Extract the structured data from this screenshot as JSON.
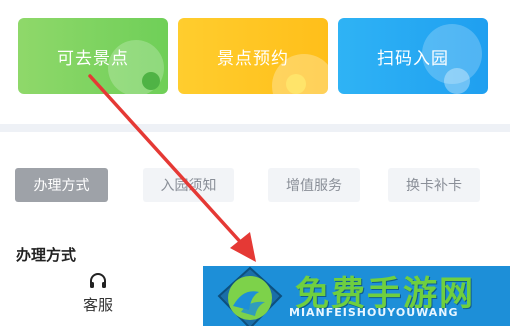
{
  "cards": [
    {
      "label": "可去景点",
      "color": "#6fcf58"
    },
    {
      "label": "景点预约",
      "color": "#ffc21f"
    },
    {
      "label": "扫码入园",
      "color": "#22a3f2"
    }
  ],
  "tabs": [
    {
      "label": "办理方式",
      "active": true
    },
    {
      "label": "入园须知",
      "active": false
    },
    {
      "label": "增值服务",
      "active": false
    },
    {
      "label": "换卡补卡",
      "active": false
    }
  ],
  "section": {
    "title": "办理方式"
  },
  "service": {
    "label": "客服",
    "icon": "headset-icon"
  },
  "watermark": {
    "text": "免费手游网",
    "subtext": "MIANFEISHOUYOUWANG"
  },
  "annotation": {
    "arrow_color": "#e53935"
  }
}
